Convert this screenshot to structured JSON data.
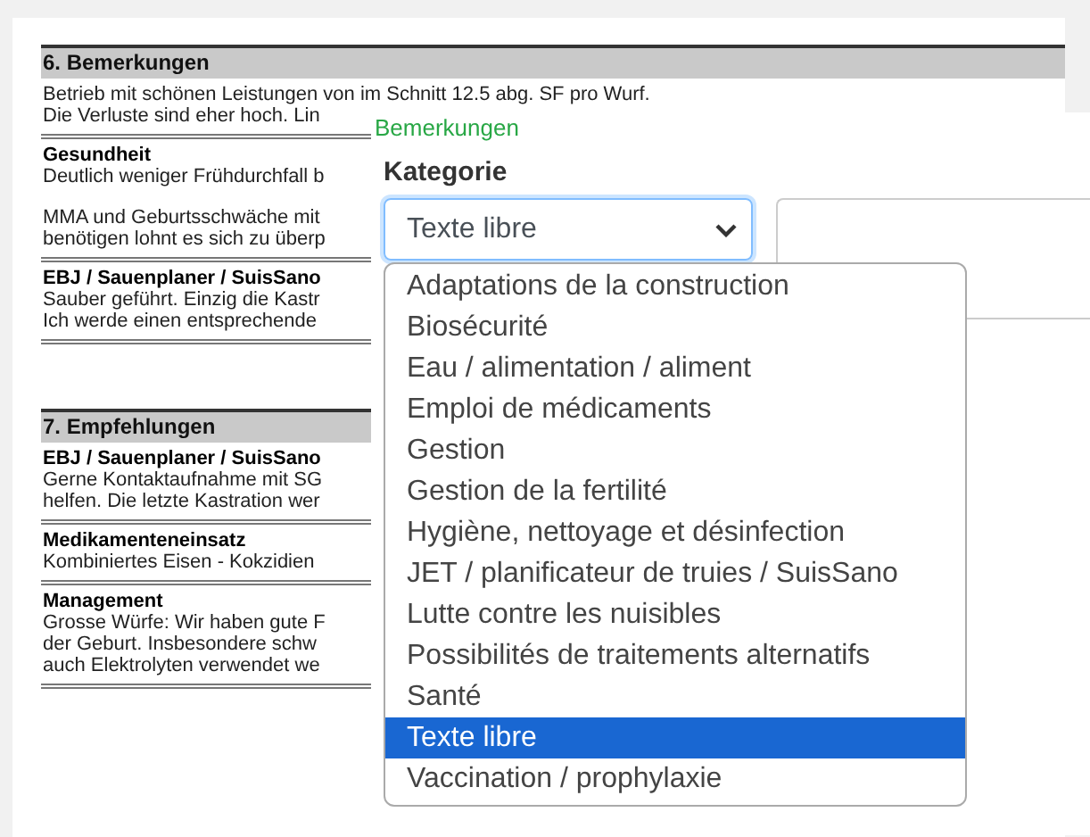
{
  "document": {
    "sections": [
      {
        "heading": "6. Bemerkungen",
        "intro": [
          "Betrieb mit schönen Leistungen von im Schnitt 12.5 abg. SF pro Wurf.",
          "Die Verluste sind eher hoch. Lin"
        ],
        "blocks": [
          {
            "title": "Gesundheit",
            "paragraphs": [
              [
                "Deutlich weniger Frühdurchfall b"
              ],
              [
                "MMA und Geburtsschwäche mit",
                "benötigen lohnt es sich zu überp"
              ]
            ]
          },
          {
            "title": "EBJ / Sauenplaner / SuisSano",
            "paragraphs": [
              [
                "Sauber geführt. Einzig die Kastr",
                "Ich werde einen entsprechende"
              ]
            ]
          }
        ]
      },
      {
        "heading": "7. Empfehlungen",
        "blocks": [
          {
            "title": "EBJ / Sauenplaner / SuisSano",
            "paragraphs": [
              [
                "Gerne Kontaktaufnahme mit SG",
                "helfen. Die letzte Kastration wer"
              ]
            ]
          },
          {
            "title": "Medikamenteneinsatz",
            "paragraphs": [
              [
                "Kombiniertes Eisen - Kokzidien"
              ]
            ]
          },
          {
            "title": "Management",
            "paragraphs": [
              [
                "Grosse Würfe: Wir haben gute F",
                "der Geburt. Insbesondere schw",
                "auch Elektrolyten verwendet we"
              ]
            ]
          }
        ]
      }
    ]
  },
  "popup": {
    "title": "Bemerkungen",
    "category_label": "Kategorie",
    "category_value": "Texte libre",
    "options": [
      {
        "label": "Adaptations de la construction",
        "selected": false
      },
      {
        "label": "Biosécurité",
        "selected": false
      },
      {
        "label": "Eau / alimentation / aliment",
        "selected": false
      },
      {
        "label": "Emploi de médicaments",
        "selected": false
      },
      {
        "label": "Gestion",
        "selected": false
      },
      {
        "label": "Gestion de la fertilité",
        "selected": false
      },
      {
        "label": "Hygiène, nettoyage et désinfection",
        "selected": false
      },
      {
        "label": "JET / planificateur de truies / SuisSano",
        "selected": false
      },
      {
        "label": "Lutte contre les nuisibles",
        "selected": false
      },
      {
        "label": "Possibilités de traitements alternatifs",
        "selected": false
      },
      {
        "label": "Santé",
        "selected": false
      },
      {
        "label": "Texte libre",
        "selected": true
      },
      {
        "label": "Vaccination / prophylaxie",
        "selected": false
      }
    ]
  }
}
